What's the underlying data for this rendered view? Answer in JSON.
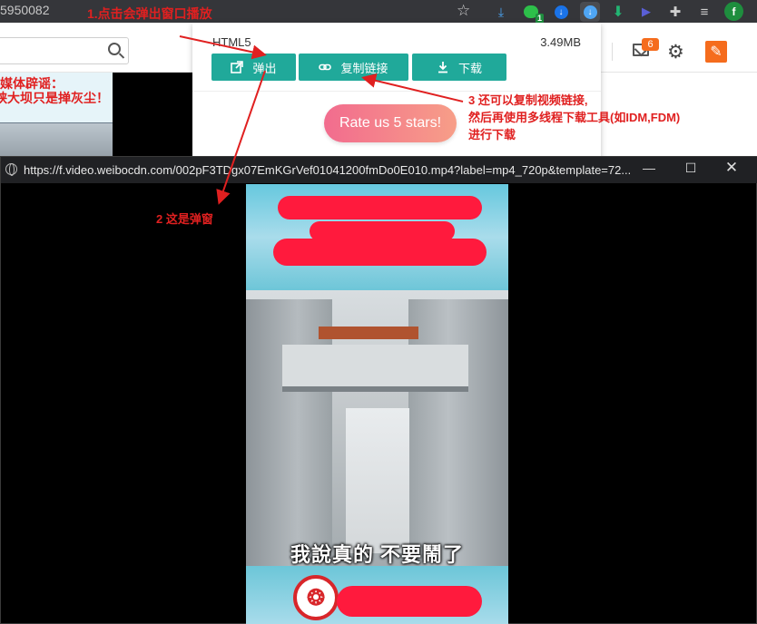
{
  "browser": {
    "url_fragment": "5950082",
    "profile_initial": "f",
    "extension_badge": "1"
  },
  "page": {
    "message_count": "6",
    "thumb_lines": [
      "媒体辟谣：",
      "峡大坝只是掸灰尘！"
    ]
  },
  "popup": {
    "format": "HTML5",
    "size": "3.49MB",
    "buttons": {
      "popout": "弹出",
      "copy_link": "复制链接",
      "download": "下载"
    },
    "rate": "Rate us 5 stars!"
  },
  "player_window": {
    "url": "https://f.video.weibocdn.com/002pF3TDgx07EmKGrVef01041200fmDo0E010.mp4?label=mp4_720p&template=72...",
    "subtitle": "我說真的 不要鬧了"
  },
  "annotations": {
    "step1": "1.点击会弹出窗口播放",
    "step2": "2 这是弹窗",
    "step3_lines": [
      "3 还可以复制视频链接,",
      "然后再使用多线程下载工具(如IDM,FDM)",
      "进行下载"
    ]
  }
}
